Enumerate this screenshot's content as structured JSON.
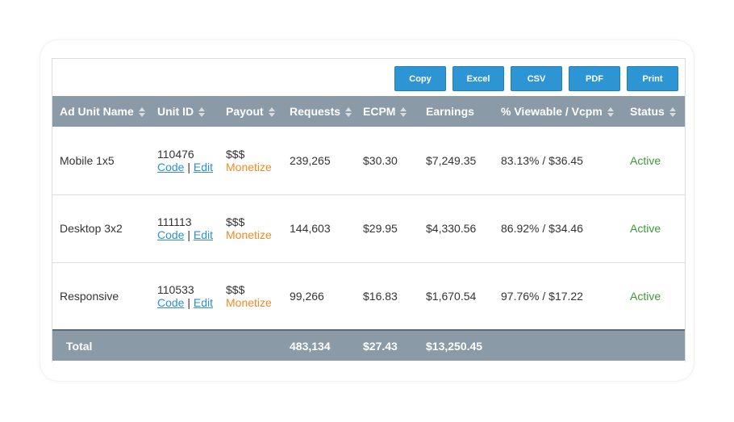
{
  "toolbar": {
    "buttons": [
      "Copy",
      "Excel",
      "CSV",
      "PDF",
      "Print"
    ]
  },
  "table": {
    "headers": [
      "Ad Unit Name",
      "Unit ID",
      "Payout",
      "Requests",
      "ECPM",
      "Earnings",
      "% Viewable / Vcpm",
      "Status"
    ],
    "rows": [
      {
        "name": "Mobile 1x5",
        "unit_id": "110476",
        "code_link": "Code",
        "edit_link": "Edit",
        "separator": "|",
        "payout": "$$$",
        "monetize": "Monetize",
        "requests": "239,265",
        "ecpm": "$30.30",
        "earnings": "$7,249.35",
        "viewable": "83.13% / $36.45",
        "status": "Active"
      },
      {
        "name": "Desktop 3x2",
        "unit_id": "111113",
        "code_link": "Code",
        "edit_link": "Edit",
        "separator": "|",
        "payout": "$$$",
        "monetize": "Monetize",
        "requests": "144,603",
        "ecpm": "$29.95",
        "earnings": "$4,330.56",
        "viewable": "86.92% / $34.46",
        "status": "Active"
      },
      {
        "name": "Responsive",
        "unit_id": "110533",
        "code_link": "Code",
        "edit_link": "Edit",
        "separator": "|",
        "payout": "$$$",
        "monetize": "Monetize",
        "requests": "99,266",
        "ecpm": "$16.83",
        "earnings": "$1,670.54",
        "viewable": "97.76% / $17.22",
        "status": "Active"
      }
    ],
    "footer": {
      "label": "Total",
      "requests": "483,134",
      "ecpm": "$27.43",
      "earnings": "$13,250.45"
    }
  },
  "colors": {
    "header_bg": "#8a9aa7",
    "button_bg": "#2e95d4",
    "link": "#2e8fd1",
    "monetize": "#f08a24",
    "active": "#3a9a3a"
  }
}
